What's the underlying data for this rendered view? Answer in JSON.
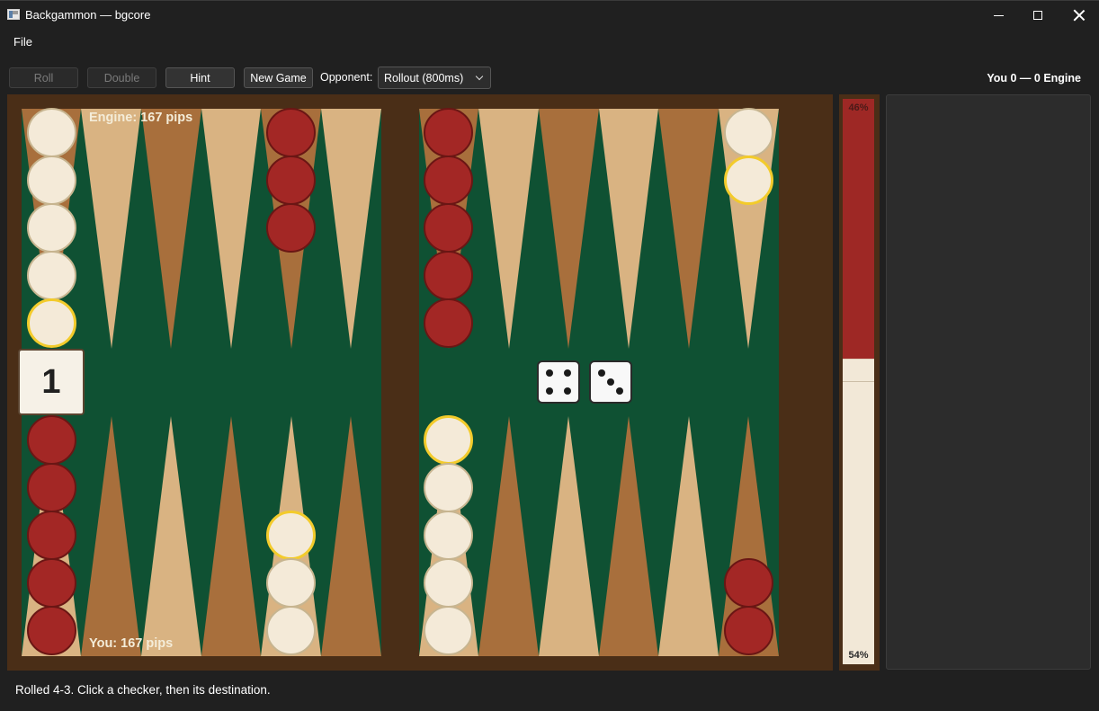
{
  "window": {
    "title": "Backgammon — bgcore"
  },
  "menu": {
    "file": "File"
  },
  "toolbar": {
    "roll": "Roll",
    "double": "Double",
    "hint": "Hint",
    "new_game": "New Game",
    "opponent_label": "Opponent:",
    "opponent_value": "Rollout (800ms)",
    "score": "You 0 — 0 Engine"
  },
  "board": {
    "engine_pips": "Engine: 167 pips",
    "you_pips": "You: 167 pips",
    "cube_value": "1",
    "dice": [
      4,
      3
    ],
    "colors": {
      "felt": "#0f5133",
      "frame": "#4a2e17",
      "point_light": "#d9b382",
      "point_dark": "#a86f3c",
      "checker_light": "#f4ead8",
      "checker_dark": "#a32725",
      "selected_ring": "#f3cb2b"
    }
  },
  "equity": {
    "top": "46%",
    "bottom": "54%",
    "engine_fraction": 0.46,
    "you_fraction": 0.54
  },
  "status": "Rolled 4-3. Click a checker, then its destination."
}
